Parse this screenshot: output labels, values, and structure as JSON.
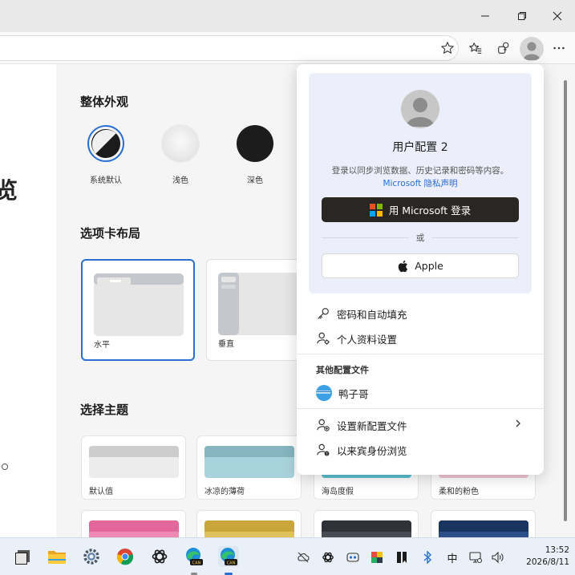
{
  "window": {
    "controls": {
      "minimize": "minimize",
      "maximize": "restore",
      "close": "close"
    }
  },
  "toolbar": {
    "icons": [
      "star-icon",
      "favorites-icon",
      "collections-icon",
      "profile-icon",
      "more-icon"
    ]
  },
  "settings": {
    "appearance": {
      "title": "整体外观",
      "options": [
        {
          "label": "系统默认",
          "selected": true
        },
        {
          "label": "浅色",
          "selected": false
        },
        {
          "label": "深色",
          "selected": false
        }
      ]
    },
    "tab_layout": {
      "title": "选项卡布局",
      "options": [
        {
          "label": "水平",
          "selected": true
        },
        {
          "label": "垂直",
          "selected": false
        }
      ]
    },
    "themes": {
      "title": "选择主题",
      "items": [
        {
          "label": "默认值",
          "color": "#e2e2e2"
        },
        {
          "label": "冰凉的薄荷",
          "color": "#9fc9d3"
        },
        {
          "label": "海岛度假",
          "color": "#56b8c9"
        },
        {
          "label": "柔和的粉色",
          "color": "#e7b7c3"
        },
        {
          "label": "",
          "color": "#e979a8"
        },
        {
          "label": "",
          "color": "#d7b54a"
        },
        {
          "label": "",
          "color": "#3b3f46"
        },
        {
          "label": "",
          "color": "#1f3e6e"
        }
      ]
    },
    "left_fragment": "览"
  },
  "profile_flyout": {
    "profile_name": "用户配置 2",
    "description": "登录以同步浏览数据、历史记录和密码等内容。",
    "privacy_link": "Microsoft 隐私声明",
    "ms_signin": "用 Microsoft 登录",
    "or_text": "或",
    "apple_signin": "Apple",
    "menu": {
      "passwords": "密码和自动填充",
      "profile_settings": "个人资料设置"
    },
    "other_profiles_title": "其他配置文件",
    "other_profile_name": "鸭子哥",
    "setup_new": "设置新配置文件",
    "guest": "以来宾身份浏览"
  },
  "taskbar": {
    "apps": [
      "desktop-icon",
      "file-explorer-icon",
      "settings-icon",
      "chrome-icon",
      "chatgpt-icon",
      "edge-can-icon",
      "edge-can-icon-2"
    ],
    "tray": {
      "ime": "中"
    },
    "time": "13:52",
    "date": "2026/8/11"
  },
  "colors": {
    "accent": "#2a6fd1",
    "ms_button": "#2a2624",
    "flyout_panel": "#eceff9"
  }
}
